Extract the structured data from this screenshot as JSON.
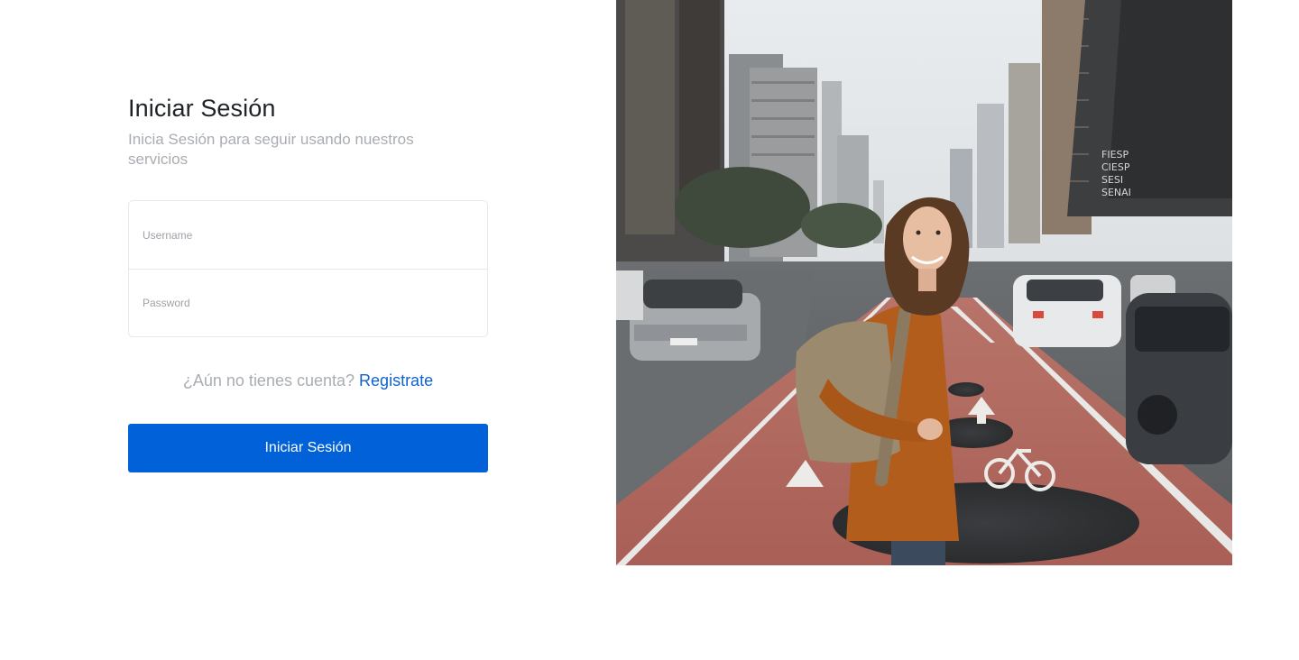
{
  "login": {
    "title": "Iniciar Sesión",
    "subtitle": "Inicia Sesión para seguir usando nuestros servicios",
    "username_placeholder": "Username",
    "password_placeholder": "Password",
    "signup_prompt": "¿Aún no tienes cuenta?",
    "signup_link": "Registrate",
    "submit_label": "Iniciar Sesión"
  },
  "colors": {
    "primary": "#0061d8",
    "link": "#1063cf",
    "muted_text": "#a9adb2",
    "title_text": "#1f2326"
  },
  "hero": {
    "photo_icon": "city-street-photo",
    "sign_text": "FIESP CIESP SESI SENAI"
  }
}
